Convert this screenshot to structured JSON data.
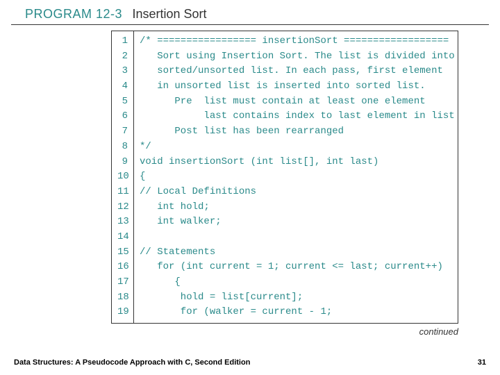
{
  "header": {
    "program_label": "PROGRAM 12-3",
    "program_title": "Insertion Sort"
  },
  "code": {
    "line_numbers": "1\n2\n3\n4\n5\n6\n7\n8\n9\n10\n11\n12\n13\n14\n15\n16\n17\n18\n19",
    "content": "/* ================= insertionSort ==================\n   Sort using Insertion Sort. The list is divided into\n   sorted/unsorted list. In each pass, first element\n   in unsorted list is inserted into sorted list.\n      Pre  list must contain at least one element\n           last contains index to last element in list\n      Post list has been rearranged\n*/\nvoid insertionSort (int list[], int last)\n{\n// Local Definitions\n   int hold;\n   int walker;\n\n// Statements\n   for (int current = 1; current <= last; current++)\n      {\n       hold = list[current];\n       for (walker = current - 1;"
  },
  "continued_label": "continued",
  "footer": {
    "book_title": "Data Structures: A Pseudocode Approach with C, Second Edition",
    "page_number": "31"
  }
}
